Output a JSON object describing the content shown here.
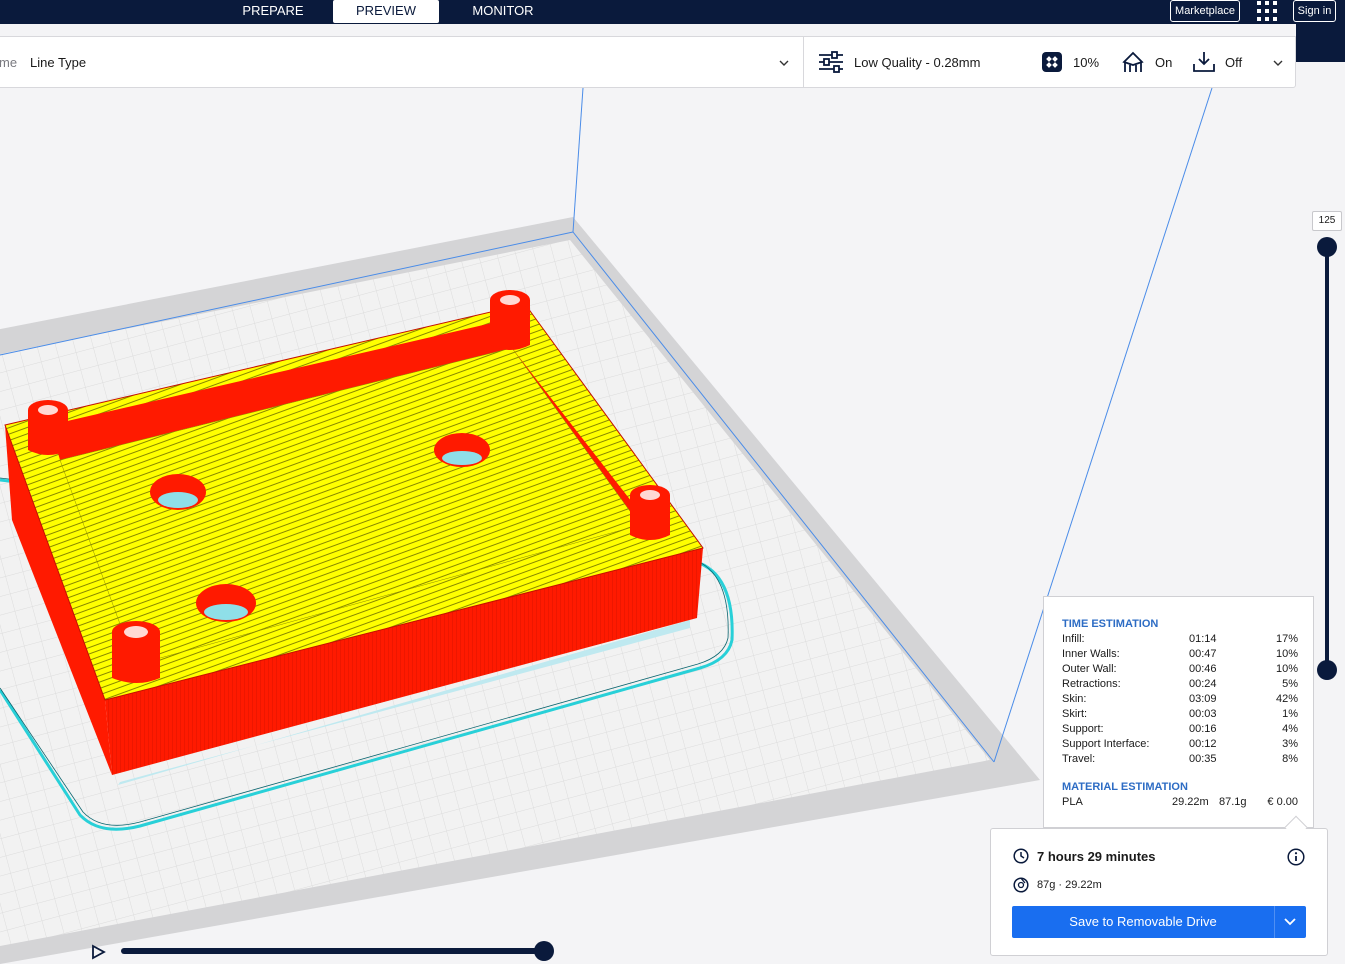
{
  "header": {
    "stages": [
      {
        "label": "PREPARE",
        "active": false
      },
      {
        "label": "PREVIEW",
        "active": true
      },
      {
        "label": "MONITOR",
        "active": false
      }
    ],
    "marketplace_label": "Marketplace",
    "signin_label": "Sign in"
  },
  "toolbar": {
    "view_label_partial": "me",
    "view_type_value": "Line Type",
    "quality_profile": "Low Quality - 0.28mm",
    "infill": "10%",
    "support": "On",
    "adhesion": "Off"
  },
  "layer_slider": {
    "current_layer": "125"
  },
  "print_info": {
    "time_title": "TIME ESTIMATION",
    "time_rows": [
      {
        "name": "Infill:",
        "time": "01:14",
        "percent": "17%"
      },
      {
        "name": "Inner Walls:",
        "time": "00:47",
        "percent": "10%"
      },
      {
        "name": "Outer Wall:",
        "time": "00:46",
        "percent": "10%"
      },
      {
        "name": "Retractions:",
        "time": "00:24",
        "percent": "5%"
      },
      {
        "name": "Skin:",
        "time": "03:09",
        "percent": "42%"
      },
      {
        "name": "Skirt:",
        "time": "00:03",
        "percent": "1%"
      },
      {
        "name": "Support:",
        "time": "00:16",
        "percent": "4%"
      },
      {
        "name": "Support Interface:",
        "time": "00:12",
        "percent": "3%"
      },
      {
        "name": "Travel:",
        "time": "00:35",
        "percent": "8%"
      }
    ],
    "material_title": "MATERIAL ESTIMATION",
    "material": {
      "name": "PLA",
      "length": "29.22m",
      "weight": "87.1g",
      "cost": "€ 0.00"
    }
  },
  "action_panel": {
    "print_time": "7 hours 29 minutes",
    "material_summary": "87g · 29.22m",
    "save_button": "Save to Removable Drive"
  },
  "colors": {
    "header_bg": "#0a1a3c",
    "accent_blue": "#196ef0",
    "model_wall": "#ff1a00",
    "model_skin": "#ffff00",
    "skirt": "#28d0d8"
  }
}
